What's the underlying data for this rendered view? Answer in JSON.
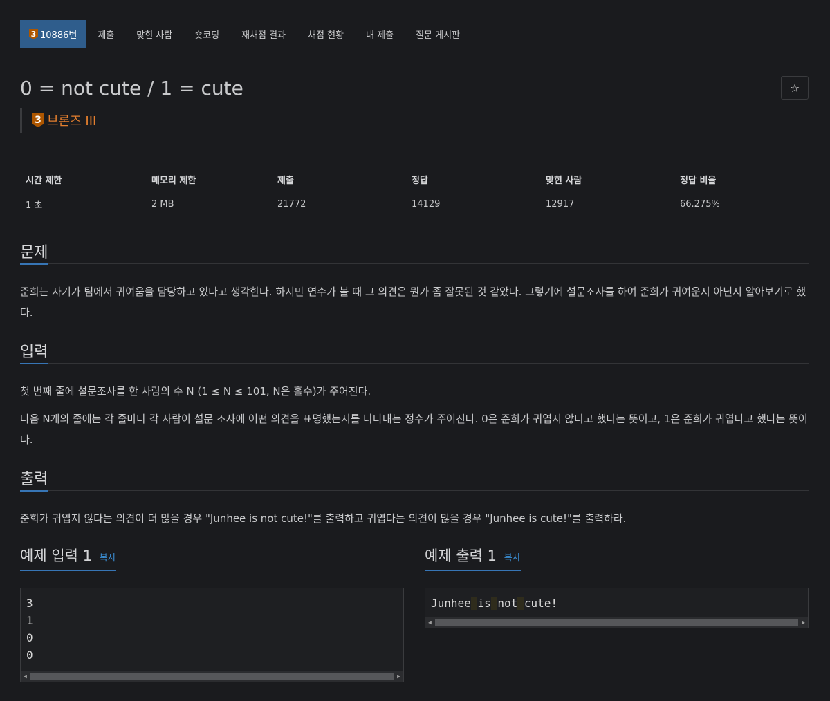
{
  "nav": {
    "problem_number": "10886번",
    "tier_digit": "3",
    "items": [
      "제출",
      "맞힌 사람",
      "숏코딩",
      "재채점 결과",
      "채점 현황",
      "내 제출",
      "질문 게시판"
    ]
  },
  "problem": {
    "title": "0 = not cute / 1 = cute",
    "tier_label": "브론즈 III",
    "star_icon": "star-icon"
  },
  "info_table": {
    "headers": [
      "시간 제한",
      "메모리 제한",
      "제출",
      "정답",
      "맞힌 사람",
      "정답 비율"
    ],
    "values": [
      "1 초",
      "2 MB",
      "21772",
      "14129",
      "12917",
      "66.275%"
    ]
  },
  "sections": {
    "problem_heading": "문제",
    "problem_text": "준희는 자기가 팀에서 귀여움을 담당하고 있다고 생각한다. 하지만 연수가 볼 때 그 의견은 뭔가 좀 잘못된 것 같았다. 그렇기에 설문조사를 하여 준희가 귀여운지 아닌지 알아보기로 했다.",
    "input_heading": "입력",
    "input_text_1": "첫 번째 줄에 설문조사를 한 사람의 수 N (1 ≤ N ≤ 101, N은 홀수)가 주어진다.",
    "input_text_2": "다음 N개의 줄에는 각 줄마다 각 사람이 설문 조사에 어떤 의견을 표명했는지를 나타내는 정수가 주어진다. 0은 준희가 귀엽지 않다고 했다는 뜻이고, 1은 준희가 귀엽다고 했다는 뜻이다.",
    "output_heading": "출력",
    "output_text": "준희가 귀엽지 않다는 의견이 더 많을 경우 \"Junhee is not cute!\"를 출력하고 귀엽다는 의견이 많을 경우 \"Junhee is cute!\"를 출력하라."
  },
  "samples": {
    "input_heading": "예제 입력 1",
    "output_heading": "예제 출력 1",
    "copy_label": "복사",
    "input_lines": [
      "3",
      "1",
      "0",
      "0"
    ],
    "output_words": [
      "Junhee",
      "is",
      "not",
      "cute!"
    ]
  }
}
